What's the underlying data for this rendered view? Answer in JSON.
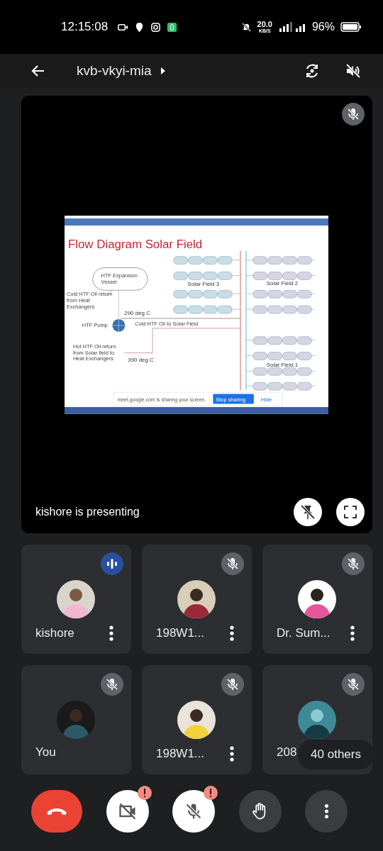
{
  "status_bar": {
    "time": "12:15:08",
    "speed": "20.0",
    "speed_unit": "KB/S",
    "battery": "96%"
  },
  "top_bar": {
    "meeting_code": "kvb-vkyi-mia"
  },
  "presentation": {
    "muted": true,
    "caption": "kishore is presenting",
    "slide": {
      "title": "Flow Diagram Solar Field",
      "vessel": [
        "HTF Expansion",
        "Vessel"
      ],
      "cold_return": [
        "Cold HTF Oil return",
        "from  Heat",
        "Exchangers"
      ],
      "cold_temp": "290 deg C",
      "pump": "HTF Pump",
      "cold_supply": "Cold HTF Oil to Solar Field",
      "hot_return": [
        "Hot HTF Oil return",
        "from Solar field to",
        "Heat Exchangers"
      ],
      "hot_temp": "390 deg C",
      "fields": [
        "Solar Field 3",
        "Solar Field 2",
        "Solar Field 1"
      ],
      "share_notice": "meet.google.com is sharing your screen.",
      "stop_button": "Stop sharing",
      "hide_link": "Hide"
    }
  },
  "participants": [
    {
      "name": "kishore",
      "speaking": true,
      "menu": true
    },
    {
      "name": "198W1...",
      "speaking": false,
      "menu": true
    },
    {
      "name": "Dr. Sum...",
      "speaking": false,
      "menu": true
    },
    {
      "name": "You",
      "speaking": false,
      "menu": false
    },
    {
      "name": "198W1...",
      "speaking": false,
      "menu": true
    },
    {
      "name": "208",
      "speaking": false,
      "menu": false
    }
  ],
  "others": "40 others",
  "controls": [
    {
      "kind": "end",
      "alert": false
    },
    {
      "kind": "camera",
      "alert": true
    },
    {
      "kind": "mic",
      "alert": true
    },
    {
      "kind": "hand",
      "alert": false
    },
    {
      "kind": "more",
      "alert": false
    }
  ]
}
